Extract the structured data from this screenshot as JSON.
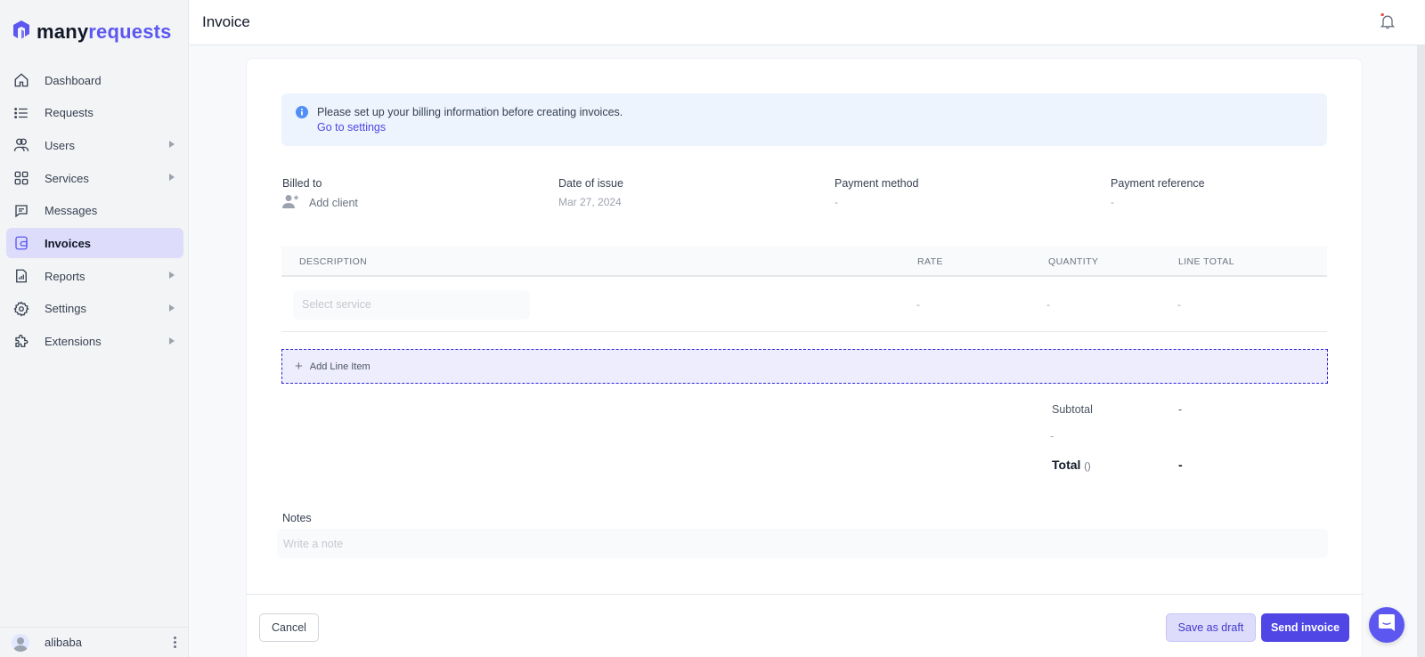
{
  "brand": {
    "name_part1": "many",
    "name_part2": "requests",
    "accent": "#5b57f0"
  },
  "sidebar": {
    "items": [
      {
        "label": "Dashboard",
        "icon": "home-icon",
        "has_submenu": false,
        "active": false
      },
      {
        "label": "Requests",
        "icon": "list-icon",
        "has_submenu": false,
        "active": false
      },
      {
        "label": "Users",
        "icon": "users-icon",
        "has_submenu": true,
        "active": false
      },
      {
        "label": "Services",
        "icon": "grid-icon",
        "has_submenu": true,
        "active": false
      },
      {
        "label": "Messages",
        "icon": "message-icon",
        "has_submenu": false,
        "active": false
      },
      {
        "label": "Invoices",
        "icon": "wallet-icon",
        "has_submenu": false,
        "active": true
      },
      {
        "label": "Reports",
        "icon": "report-icon",
        "has_submenu": true,
        "active": false
      },
      {
        "label": "Settings",
        "icon": "gear-icon",
        "has_submenu": true,
        "active": false
      },
      {
        "label": "Extensions",
        "icon": "puzzle-icon",
        "has_submenu": true,
        "active": false
      }
    ],
    "user": {
      "name": "alibaba"
    }
  },
  "header": {
    "title": "Invoice",
    "notification_dot": true
  },
  "alert": {
    "message": "Please set up your billing information before creating invoices.",
    "link": "Go to settings"
  },
  "meta": {
    "billed_to": {
      "label": "Billed to",
      "action": "Add client"
    },
    "date_of_issue": {
      "label": "Date of issue",
      "value": "Mar 27, 2024"
    },
    "payment_method": {
      "label": "Payment method",
      "value": "-"
    },
    "payment_reference": {
      "label": "Payment reference",
      "value": "-"
    }
  },
  "table": {
    "columns": [
      "DESCRIPTION",
      "RATE",
      "QUANTITY",
      "LINE TOTAL"
    ],
    "rows": [
      {
        "description_placeholder": "Select service",
        "rate": "-",
        "quantity": "-",
        "line_total": "-"
      }
    ],
    "add_line_label": "Add Line Item"
  },
  "totals": {
    "subtotal_label": "Subtotal",
    "subtotal_value": "-",
    "tax_label": "-",
    "total_label": "Total",
    "total_currency": "()",
    "total_value": "-"
  },
  "notes": {
    "label": "Notes",
    "placeholder": "Write a note",
    "value": ""
  },
  "footer": {
    "cancel": "Cancel",
    "save_draft": "Save as draft",
    "send": "Send invoice"
  }
}
